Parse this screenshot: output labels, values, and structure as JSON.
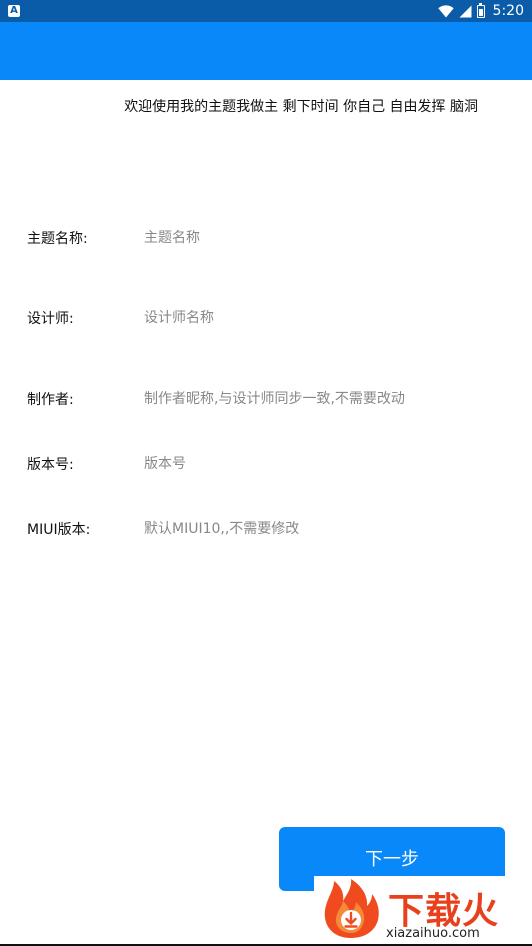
{
  "status_bar": {
    "time": "5:20"
  },
  "welcome_text": "欢迎使用我的主题我做主   剩下时间 你自己 自由发挥 脑洞",
  "form": {
    "theme_name": {
      "label": "主题名称:",
      "placeholder": "主题名称",
      "value": ""
    },
    "designer": {
      "label": "设计师:",
      "placeholder": "设计师名称",
      "value": ""
    },
    "author": {
      "label": "制作者:",
      "placeholder": "制作者昵称,与设计师同步一致,不需要改动",
      "value": ""
    },
    "version": {
      "label": "版本号:",
      "placeholder": "版本号",
      "value": ""
    },
    "miui_version": {
      "label": "MIUI版本:",
      "placeholder": "默认MIUI10,,不需要修改",
      "value": ""
    }
  },
  "next_button_label": "下一步",
  "watermark": {
    "brand": "下载火",
    "url": "xiazaihuo.com"
  },
  "colors": {
    "status_bar": "#0b5ca8",
    "app_bar": "#0988fa",
    "button": "#0988fa",
    "watermark_brand": "#e8401c"
  }
}
